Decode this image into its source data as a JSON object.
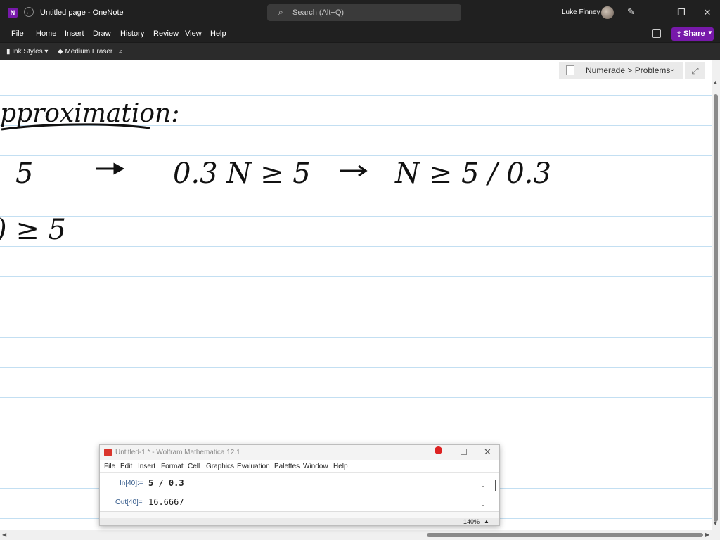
{
  "window": {
    "title": "Untitled page - OneNote",
    "search_placeholder": "Search (Alt+Q)",
    "user_name": "Luke Finney"
  },
  "menu": [
    "File",
    "Home",
    "Insert",
    "Draw",
    "History",
    "Review",
    "View",
    "Help"
  ],
  "share_label": "Share",
  "ribbon": {
    "ink_styles_label": "Ink Styles",
    "eraser_label": "Medium Eraser"
  },
  "notebook_breadcrumb": "Numerade > Problems",
  "ink_text": {
    "heading": "pproximation:",
    "line1_left": "5",
    "line1_mid": "0.3 N ≥ 5",
    "line1_right": "N ≥ 5 / 0.3",
    "line2": ") ≥ 5"
  },
  "mathematica": {
    "title": "Untitled-1 * - Wolfram Mathematica 12.1",
    "menu": [
      "File",
      "Edit",
      "Insert",
      "Format",
      "Cell",
      "Graphics",
      "Evaluation",
      "Palettes",
      "Window",
      "Help"
    ],
    "in_label": "In[40]:=",
    "in_expr": "5 / 0.3",
    "out_label": "Out[40]=",
    "out_value": "16.6667",
    "zoom": "140%"
  },
  "icons": [
    "onenote-icon",
    "back-icon",
    "search-icon",
    "pen-icon",
    "minimize-icon",
    "restore-icon",
    "close-icon",
    "layout-icon",
    "share-icon",
    "expand-icon",
    "mathematica-icon"
  ],
  "colors": {
    "onenote_purple": "#7719aa",
    "ruled_line": "#c3dff2",
    "titlebar": "#202020"
  }
}
